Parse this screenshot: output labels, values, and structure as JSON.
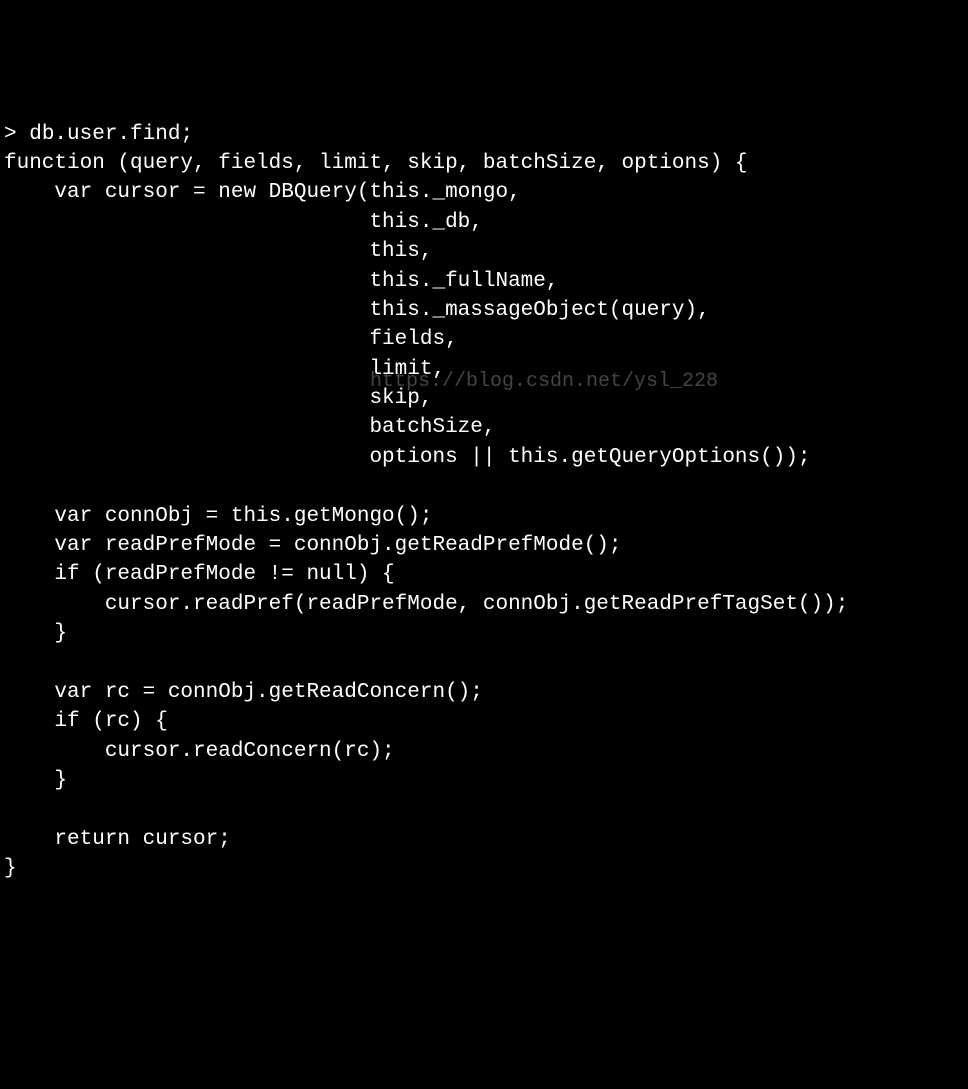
{
  "terminal": {
    "prompt": "> ",
    "command": "db.user.find;",
    "lines": [
      "function (query, fields, limit, skip, batchSize, options) {",
      "    var cursor = new DBQuery(this._mongo,",
      "                             this._db,",
      "                             this,",
      "                             this._fullName,",
      "                             this._massageObject(query),",
      "                             fields,",
      "                             limit,",
      "                             skip,",
      "                             batchSize,",
      "                             options || this.getQueryOptions());",
      "",
      "    var connObj = this.getMongo();",
      "    var readPrefMode = connObj.getReadPrefMode();",
      "    if (readPrefMode != null) {",
      "        cursor.readPref(readPrefMode, connObj.getReadPrefTagSet());",
      "    }",
      "",
      "    var rc = connObj.getReadConcern();",
      "    if (rc) {",
      "        cursor.readConcern(rc);",
      "    }",
      "",
      "    return cursor;",
      "}"
    ]
  },
  "watermark": "https://blog.csdn.net/ysl_228"
}
